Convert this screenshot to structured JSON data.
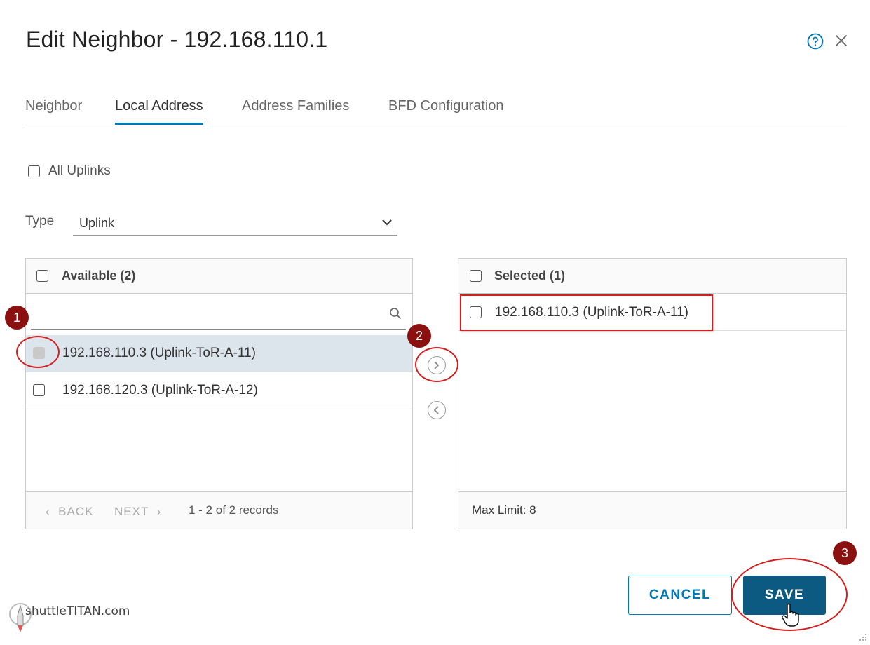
{
  "dialog": {
    "title": "Edit Neighbor - 192.168.110.1"
  },
  "tabs": [
    {
      "label": "Neighbor",
      "active": false
    },
    {
      "label": "Local Address",
      "active": true
    },
    {
      "label": "Address Families",
      "active": false
    },
    {
      "label": "BFD Configuration",
      "active": false
    }
  ],
  "all_uplinks": {
    "label": "All Uplinks",
    "checked": false
  },
  "type_field": {
    "label": "Type",
    "value": "Uplink"
  },
  "available": {
    "header": "Available (2)",
    "search_placeholder": "",
    "rows": [
      {
        "label": "192.168.110.3 (Uplink-ToR-A-11)",
        "highlighted": true
      },
      {
        "label": "192.168.120.3 (Uplink-ToR-A-12)",
        "highlighted": false
      }
    ],
    "footer": {
      "back": "BACK",
      "next": "NEXT",
      "records": "1 - 2 of 2 records"
    }
  },
  "selected": {
    "header": "Selected (1)",
    "rows": [
      {
        "label": "192.168.110.3 (Uplink-ToR-A-11)"
      }
    ],
    "footer": "Max Limit: 8"
  },
  "buttons": {
    "cancel": "CANCEL",
    "save": "SAVE"
  },
  "annotations": {
    "step1": "1",
    "step2": "2",
    "step3": "3"
  },
  "watermark": "shuttleTITAN.com",
  "colors": {
    "accent": "#0079b8",
    "primary_button": "#0c5a82",
    "annotation": "#d21f1f",
    "badge": "#8b1010"
  }
}
